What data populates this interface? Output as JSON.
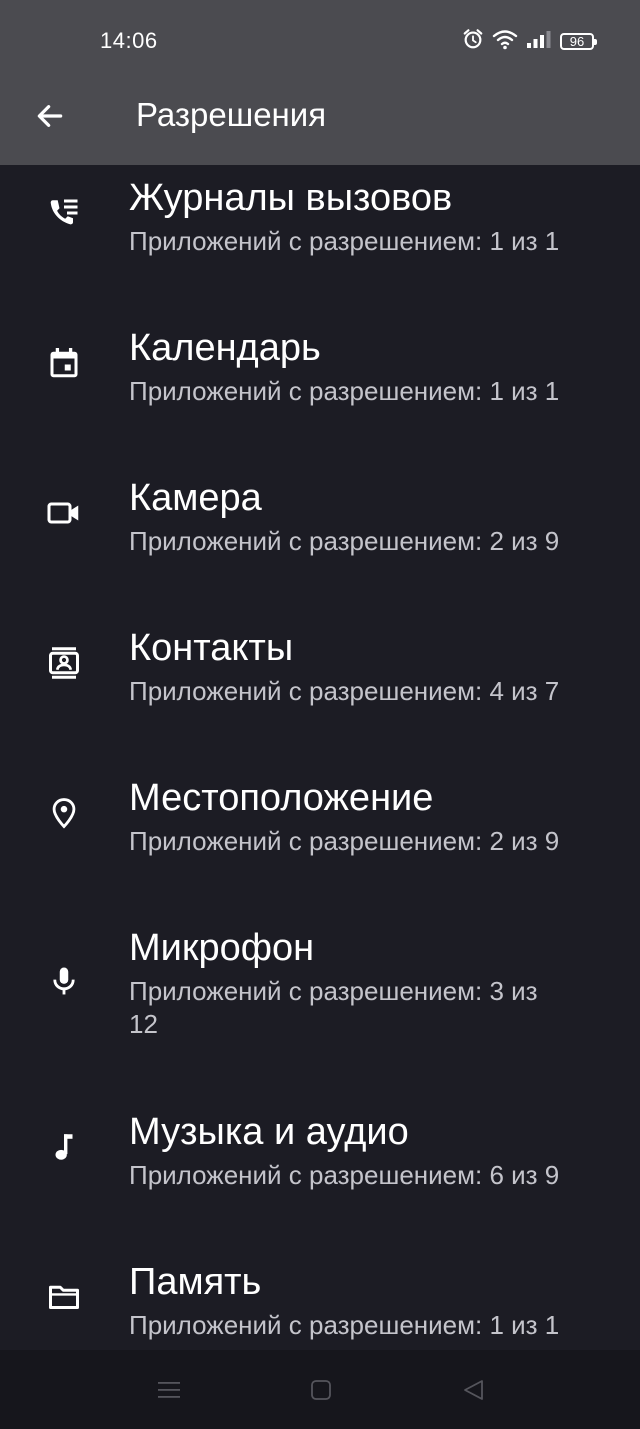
{
  "status_bar": {
    "time": "14:06",
    "battery": "96",
    "icons": [
      "alarm-icon",
      "wifi-icon",
      "signal-icon",
      "battery-icon"
    ]
  },
  "app_bar": {
    "title": "Разрешения",
    "back_icon": "arrow-back-icon"
  },
  "permissions": [
    {
      "icon": "call-log-icon",
      "title": "Журналы вызовов",
      "summary": "Приложений с разрешением: 1 из 1"
    },
    {
      "icon": "calendar-icon",
      "title": "Календарь",
      "summary": "Приложений с разрешением: 1 из 1"
    },
    {
      "icon": "camera-icon",
      "title": "Камера",
      "summary": "Приложений с разрешением: 2 из 9"
    },
    {
      "icon": "contacts-icon",
      "title": "Контакты",
      "summary": "Приложений с разрешением: 4 из 7"
    },
    {
      "icon": "location-icon",
      "title": "Местоположение",
      "summary": "Приложений с разрешением: 2 из 9"
    },
    {
      "icon": "microphone-icon",
      "title": "Микрофон",
      "summary": "Приложений с разрешением: 3 из 12"
    },
    {
      "icon": "music-note-icon",
      "title": "Музыка и аудио",
      "summary": "Приложений с разрешением: 6 из 9"
    },
    {
      "icon": "folder-icon",
      "title": "Память",
      "summary": "Приложений с разрешением: 1 из 1"
    }
  ],
  "nav_bar": {
    "icons": [
      "menu-icon",
      "home-icon",
      "back-triangle-icon"
    ]
  },
  "colors": {
    "background": "#1c1c24",
    "app_bar": "#4b4b50",
    "title_text": "#ffffff",
    "summary_text": "#c4c4cb",
    "nav_bar": "#16161c"
  }
}
